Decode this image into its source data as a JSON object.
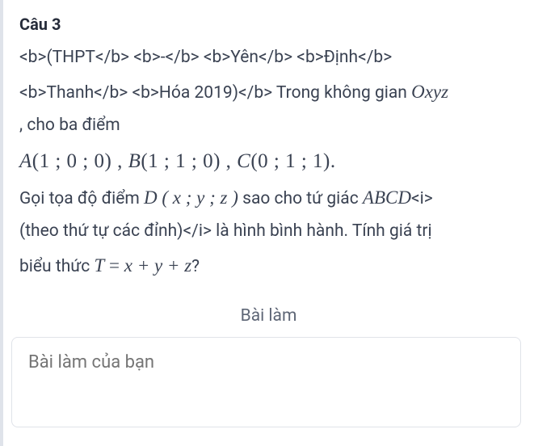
{
  "question": {
    "header": "Câu 3",
    "line1_raw": "<b>(THPT</b> <b>-</b> <b>Yên</b> <b>Định</b>",
    "line2_prefix_raw": "<b>Thanh</b> <b>Hóa 2019)</b> Trong không gian ",
    "line2_math": "Oxyz",
    "line3": ", cho ba điểm",
    "points_line": {
      "A_label": "A",
      "A_coords": "(1 ; 0 ; 0)",
      "sep1": " , ",
      "B_label": "B",
      "B_coords": "(1 ; 1 ; 0)",
      "sep2": " , ",
      "C_label": "C",
      "C_coords": "(0 ; 1 ; 1).",
      "full_fallback": "A(1 ; 0 ; 0) , B(1 ; 1 ; 0) , C(0 ; 1 ; 1)."
    },
    "line5_a": "Gọi tọa độ điểm ",
    "line5_Dmath": "D ( x ; y ; z )",
    "line5_b": " sao cho tứ giác ",
    "line5_ABCD": "ABCD",
    "line5_c_raw": "<i>",
    "line6_raw": "(theo thứ tự các đỉnh)</i> là hình bình hành. Tính giá trị",
    "line7_a": "biểu thức ",
    "line7_T": "T",
    "line7_eq": " = ",
    "line7_expr": "x + y + z",
    "line7_b": "?"
  },
  "section_label": "Bài làm",
  "answer_placeholder": "Bài làm của bạn"
}
